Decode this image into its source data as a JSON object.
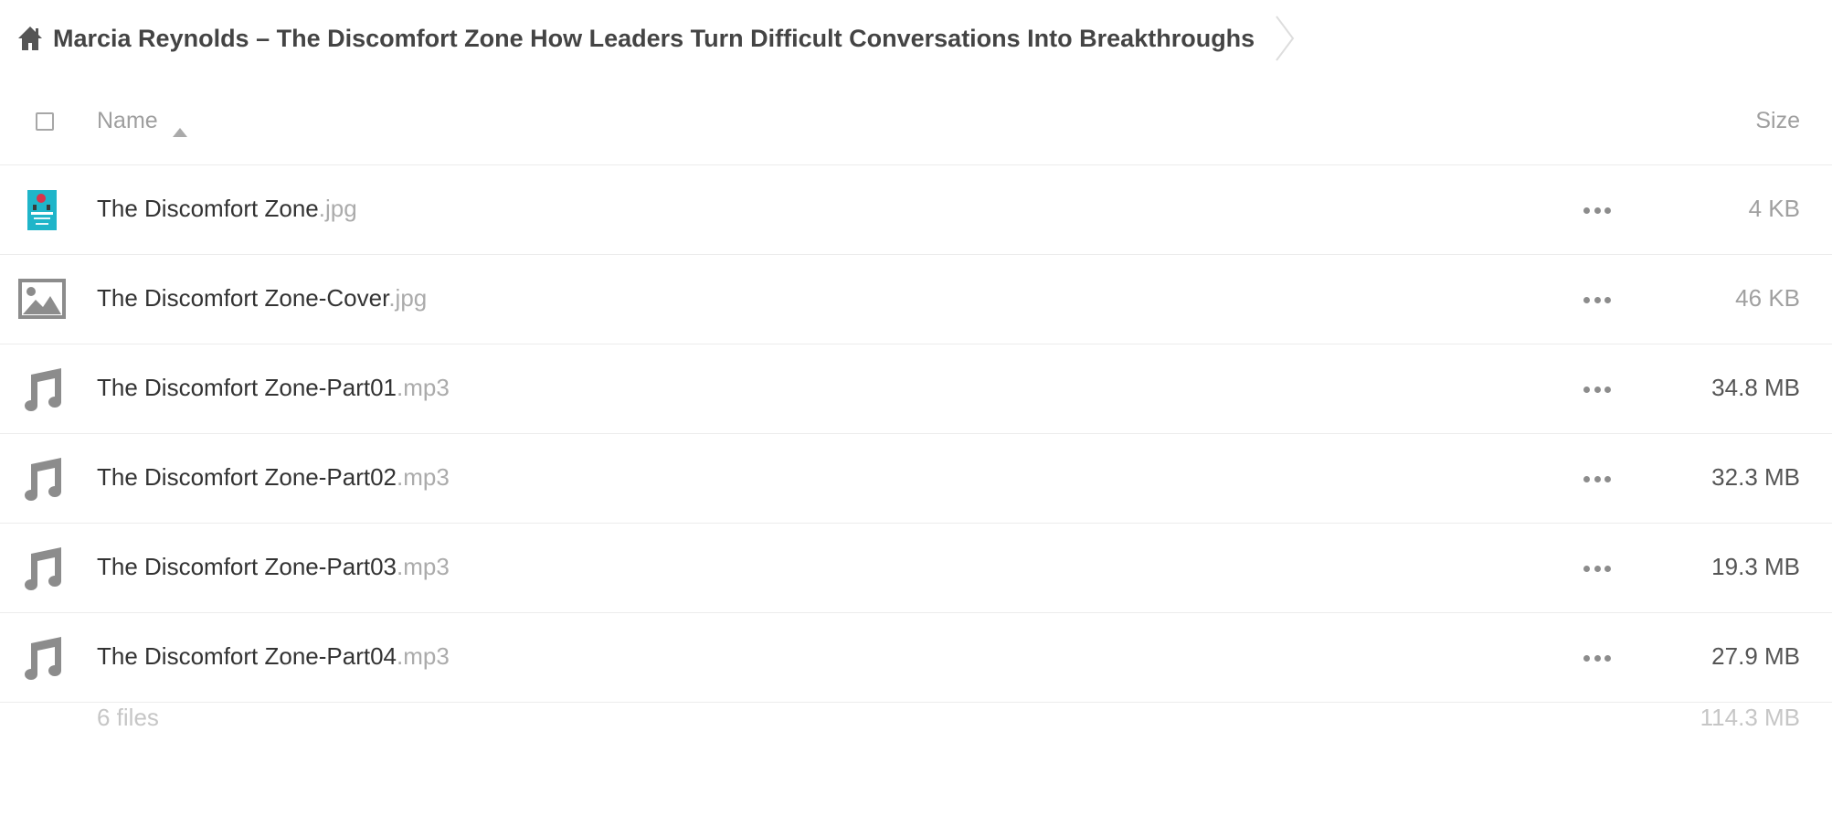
{
  "breadcrumb": {
    "home_icon": "home-icon",
    "folder_title": "Marcia Reynolds – The Discomfort Zone How Leaders Turn Difficult Conversations Into Breakthroughs"
  },
  "table_header": {
    "name_label": "Name",
    "sort_icon": "sort-ascending-icon",
    "size_label": "Size"
  },
  "files": [
    {
      "base": "The Discomfort Zone",
      "ext": ".jpg",
      "size": "4 KB",
      "icon": "book-cover-thumbnail",
      "size_color": "#a0a0a0"
    },
    {
      "base": "The Discomfort Zone-Cover",
      "ext": ".jpg",
      "size": "46 KB",
      "icon": "image-icon",
      "size_color": "#a0a0a0"
    },
    {
      "base": "The Discomfort Zone-Part01",
      "ext": ".mp3",
      "size": "34.8 MB",
      "icon": "music-note-icon",
      "size_color": "#555555"
    },
    {
      "base": "The Discomfort Zone-Part02",
      "ext": ".mp3",
      "size": "32.3 MB",
      "icon": "music-note-icon",
      "size_color": "#555555"
    },
    {
      "base": "The Discomfort Zone-Part03",
      "ext": ".mp3",
      "size": "19.3 MB",
      "icon": "music-note-icon",
      "size_color": "#555555"
    },
    {
      "base": "The Discomfort Zone-Part04",
      "ext": ".mp3",
      "size": "27.9 MB",
      "icon": "music-note-icon",
      "size_color": "#555555"
    }
  ],
  "summary": {
    "count": "6 files",
    "total_size": "114.3 MB"
  },
  "colors": {
    "icon_gray": "#8c8c8c",
    "thumbnail_teal": "#1fb5c9",
    "thumbnail_red": "#d9334a"
  }
}
